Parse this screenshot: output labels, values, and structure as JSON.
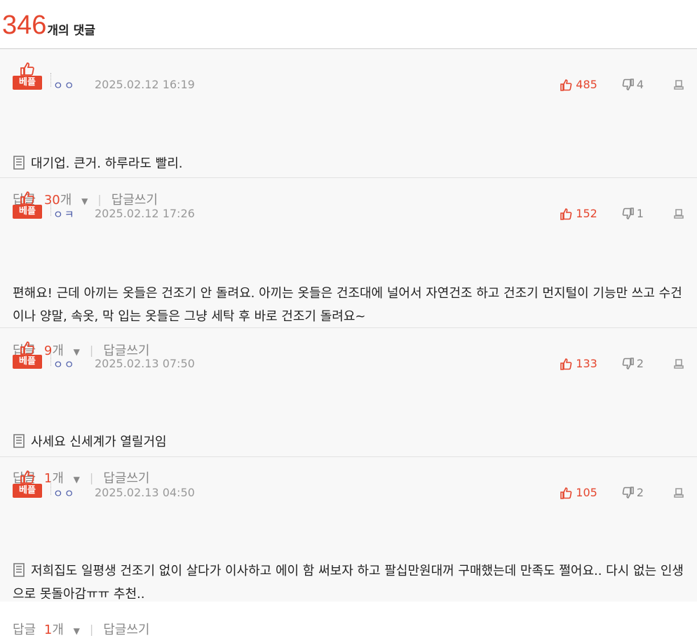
{
  "header": {
    "count": "346",
    "label": "개의 댓글"
  },
  "colors": {
    "accent": "#e5462e",
    "user": "#4a5aa8"
  },
  "comments": [
    {
      "badge": "베플",
      "user": "ㅇㅇ",
      "date": "2025.02.12 16:19",
      "up": "485",
      "down": "4",
      "has_doc_icon": true,
      "text": "대기업. 큰거. 하루라도 빨리.",
      "reply_label": "답글",
      "reply_count": "30",
      "reply_unit": "개",
      "write_label": "답글쓰기"
    },
    {
      "badge": "베플",
      "user": "ㅇㅋ",
      "date": "2025.02.12 17:26",
      "up": "152",
      "down": "1",
      "has_doc_icon": false,
      "text": "편해요! 근데 아끼는 옷들은 건조기 안 돌려요. 아끼는 옷들은 건조대에 널어서 자연건조 하고 건조기 먼지털이 기능만 쓰고 수건이나 양말, 속옷, 막 입는 옷들은 그냥 세탁 후 바로 건조기 돌려요~",
      "reply_label": "답글",
      "reply_count": "9",
      "reply_unit": "개",
      "write_label": "답글쓰기"
    },
    {
      "badge": "베플",
      "user": "ㅇㅇ",
      "date": "2025.02.13 07:50",
      "up": "133",
      "down": "2",
      "has_doc_icon": true,
      "text": "사세요 신세계가 열릴거임",
      "reply_label": "답글",
      "reply_count": "1",
      "reply_unit": "개",
      "write_label": "답글쓰기"
    },
    {
      "badge": "베플",
      "user": "ㅇㅇ",
      "date": "2025.02.13 04:50",
      "up": "105",
      "down": "2",
      "has_doc_icon": true,
      "text": "저희집도 일평생 건조기 없이 살다가 이사하고 에이 함 써보자 하고 팔십만원대꺼 구매했는데 만족도 쩔어요.. 다시 없는 인생으로 못돌아감ㅠㅠ 추천..",
      "reply_label": "답글",
      "reply_count": "1",
      "reply_unit": "개",
      "write_label": "답글쓰기"
    }
  ]
}
